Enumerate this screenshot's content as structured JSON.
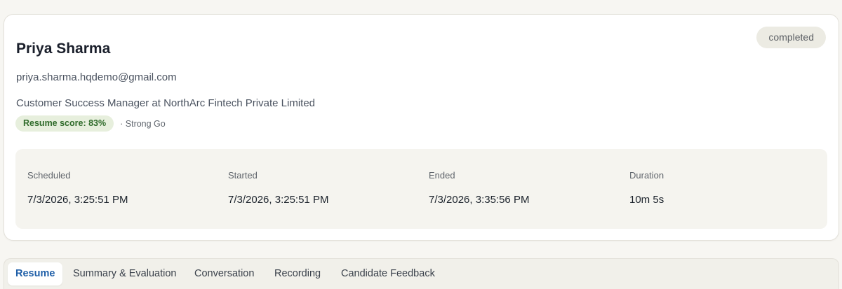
{
  "candidate": {
    "name": "Priya Sharma",
    "email": "priya.sharma.hqdemo@gmail.com",
    "role": "Customer Success Manager at NorthArc Fintech Private Limited",
    "status": "completed",
    "resume_score_label": "Resume score: 83%",
    "recommendation": "· Strong Go"
  },
  "details": [
    {
      "label": "Scheduled",
      "value": "7/3/2026, 3:25:51 PM"
    },
    {
      "label": "Started",
      "value": "7/3/2026, 3:25:51 PM"
    },
    {
      "label": "Ended",
      "value": "7/3/2026, 3:35:56 PM"
    },
    {
      "label": "Duration",
      "value": "10m 5s"
    }
  ],
  "tabs": [
    {
      "label": "Resume",
      "active": true
    },
    {
      "label": "Summary & Evaluation",
      "active": false
    },
    {
      "label": "Conversation",
      "active": false
    },
    {
      "label": "Recording",
      "active": false
    },
    {
      "label": "Candidate Feedback",
      "active": false
    }
  ],
  "colors": {
    "accent": "#1f5fa8",
    "score_bg": "#e7efdd",
    "score_text": "#2f6b2a",
    "status_bg": "#ecebe3"
  }
}
